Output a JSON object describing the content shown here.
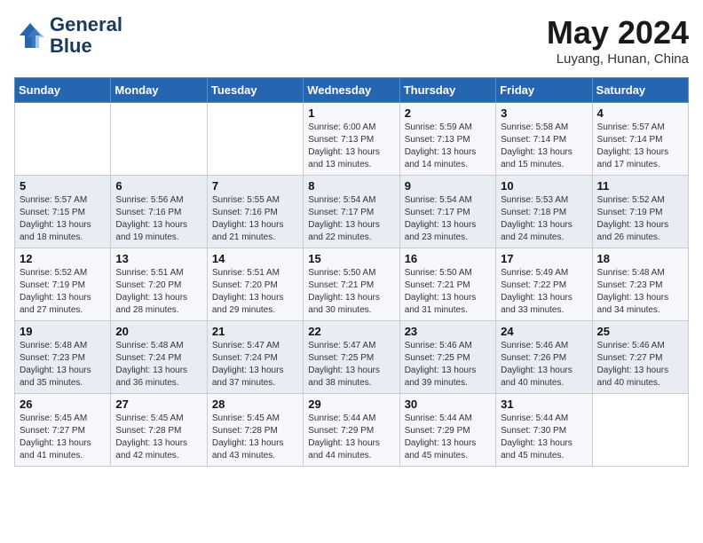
{
  "header": {
    "logo_line1": "General",
    "logo_line2": "Blue",
    "month": "May 2024",
    "location": "Luyang, Hunan, China"
  },
  "weekdays": [
    "Sunday",
    "Monday",
    "Tuesday",
    "Wednesday",
    "Thursday",
    "Friday",
    "Saturday"
  ],
  "weeks": [
    [
      {
        "num": "",
        "sunrise": "",
        "sunset": "",
        "daylight": ""
      },
      {
        "num": "",
        "sunrise": "",
        "sunset": "",
        "daylight": ""
      },
      {
        "num": "",
        "sunrise": "",
        "sunset": "",
        "daylight": ""
      },
      {
        "num": "1",
        "sunrise": "Sunrise: 6:00 AM",
        "sunset": "Sunset: 7:13 PM",
        "daylight": "Daylight: 13 hours and 13 minutes."
      },
      {
        "num": "2",
        "sunrise": "Sunrise: 5:59 AM",
        "sunset": "Sunset: 7:13 PM",
        "daylight": "Daylight: 13 hours and 14 minutes."
      },
      {
        "num": "3",
        "sunrise": "Sunrise: 5:58 AM",
        "sunset": "Sunset: 7:14 PM",
        "daylight": "Daylight: 13 hours and 15 minutes."
      },
      {
        "num": "4",
        "sunrise": "Sunrise: 5:57 AM",
        "sunset": "Sunset: 7:14 PM",
        "daylight": "Daylight: 13 hours and 17 minutes."
      }
    ],
    [
      {
        "num": "5",
        "sunrise": "Sunrise: 5:57 AM",
        "sunset": "Sunset: 7:15 PM",
        "daylight": "Daylight: 13 hours and 18 minutes."
      },
      {
        "num": "6",
        "sunrise": "Sunrise: 5:56 AM",
        "sunset": "Sunset: 7:16 PM",
        "daylight": "Daylight: 13 hours and 19 minutes."
      },
      {
        "num": "7",
        "sunrise": "Sunrise: 5:55 AM",
        "sunset": "Sunset: 7:16 PM",
        "daylight": "Daylight: 13 hours and 21 minutes."
      },
      {
        "num": "8",
        "sunrise": "Sunrise: 5:54 AM",
        "sunset": "Sunset: 7:17 PM",
        "daylight": "Daylight: 13 hours and 22 minutes."
      },
      {
        "num": "9",
        "sunrise": "Sunrise: 5:54 AM",
        "sunset": "Sunset: 7:17 PM",
        "daylight": "Daylight: 13 hours and 23 minutes."
      },
      {
        "num": "10",
        "sunrise": "Sunrise: 5:53 AM",
        "sunset": "Sunset: 7:18 PM",
        "daylight": "Daylight: 13 hours and 24 minutes."
      },
      {
        "num": "11",
        "sunrise": "Sunrise: 5:52 AM",
        "sunset": "Sunset: 7:19 PM",
        "daylight": "Daylight: 13 hours and 26 minutes."
      }
    ],
    [
      {
        "num": "12",
        "sunrise": "Sunrise: 5:52 AM",
        "sunset": "Sunset: 7:19 PM",
        "daylight": "Daylight: 13 hours and 27 minutes."
      },
      {
        "num": "13",
        "sunrise": "Sunrise: 5:51 AM",
        "sunset": "Sunset: 7:20 PM",
        "daylight": "Daylight: 13 hours and 28 minutes."
      },
      {
        "num": "14",
        "sunrise": "Sunrise: 5:51 AM",
        "sunset": "Sunset: 7:20 PM",
        "daylight": "Daylight: 13 hours and 29 minutes."
      },
      {
        "num": "15",
        "sunrise": "Sunrise: 5:50 AM",
        "sunset": "Sunset: 7:21 PM",
        "daylight": "Daylight: 13 hours and 30 minutes."
      },
      {
        "num": "16",
        "sunrise": "Sunrise: 5:50 AM",
        "sunset": "Sunset: 7:21 PM",
        "daylight": "Daylight: 13 hours and 31 minutes."
      },
      {
        "num": "17",
        "sunrise": "Sunrise: 5:49 AM",
        "sunset": "Sunset: 7:22 PM",
        "daylight": "Daylight: 13 hours and 33 minutes."
      },
      {
        "num": "18",
        "sunrise": "Sunrise: 5:48 AM",
        "sunset": "Sunset: 7:23 PM",
        "daylight": "Daylight: 13 hours and 34 minutes."
      }
    ],
    [
      {
        "num": "19",
        "sunrise": "Sunrise: 5:48 AM",
        "sunset": "Sunset: 7:23 PM",
        "daylight": "Daylight: 13 hours and 35 minutes."
      },
      {
        "num": "20",
        "sunrise": "Sunrise: 5:48 AM",
        "sunset": "Sunset: 7:24 PM",
        "daylight": "Daylight: 13 hours and 36 minutes."
      },
      {
        "num": "21",
        "sunrise": "Sunrise: 5:47 AM",
        "sunset": "Sunset: 7:24 PM",
        "daylight": "Daylight: 13 hours and 37 minutes."
      },
      {
        "num": "22",
        "sunrise": "Sunrise: 5:47 AM",
        "sunset": "Sunset: 7:25 PM",
        "daylight": "Daylight: 13 hours and 38 minutes."
      },
      {
        "num": "23",
        "sunrise": "Sunrise: 5:46 AM",
        "sunset": "Sunset: 7:25 PM",
        "daylight": "Daylight: 13 hours and 39 minutes."
      },
      {
        "num": "24",
        "sunrise": "Sunrise: 5:46 AM",
        "sunset": "Sunset: 7:26 PM",
        "daylight": "Daylight: 13 hours and 40 minutes."
      },
      {
        "num": "25",
        "sunrise": "Sunrise: 5:46 AM",
        "sunset": "Sunset: 7:27 PM",
        "daylight": "Daylight: 13 hours and 40 minutes."
      }
    ],
    [
      {
        "num": "26",
        "sunrise": "Sunrise: 5:45 AM",
        "sunset": "Sunset: 7:27 PM",
        "daylight": "Daylight: 13 hours and 41 minutes."
      },
      {
        "num": "27",
        "sunrise": "Sunrise: 5:45 AM",
        "sunset": "Sunset: 7:28 PM",
        "daylight": "Daylight: 13 hours and 42 minutes."
      },
      {
        "num": "28",
        "sunrise": "Sunrise: 5:45 AM",
        "sunset": "Sunset: 7:28 PM",
        "daylight": "Daylight: 13 hours and 43 minutes."
      },
      {
        "num": "29",
        "sunrise": "Sunrise: 5:44 AM",
        "sunset": "Sunset: 7:29 PM",
        "daylight": "Daylight: 13 hours and 44 minutes."
      },
      {
        "num": "30",
        "sunrise": "Sunrise: 5:44 AM",
        "sunset": "Sunset: 7:29 PM",
        "daylight": "Daylight: 13 hours and 45 minutes."
      },
      {
        "num": "31",
        "sunrise": "Sunrise: 5:44 AM",
        "sunset": "Sunset: 7:30 PM",
        "daylight": "Daylight: 13 hours and 45 minutes."
      },
      {
        "num": "",
        "sunrise": "",
        "sunset": "",
        "daylight": ""
      }
    ]
  ]
}
